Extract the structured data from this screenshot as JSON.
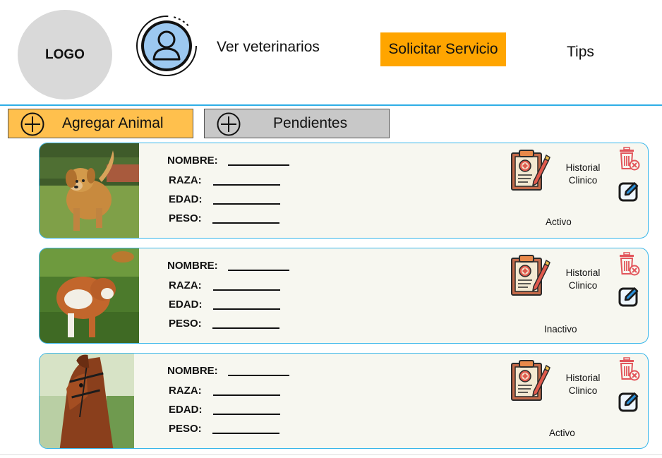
{
  "header": {
    "logo_text": "LOGO",
    "nav": {
      "ver_veterinarios": "Ver veterinarios",
      "solicitar_servicio": "Solicitar Servicio",
      "tips": "Tips"
    }
  },
  "actions": {
    "agregar_label": "Agregar Animal",
    "pendientes_label": "Pendientes"
  },
  "field_labels": {
    "nombre": "NOMBRE:",
    "raza": "RAZA:",
    "edad": "EDAD:",
    "peso": "PESO:"
  },
  "animals": [
    {
      "photo": "dog-photo",
      "historial": "Historial Clinico",
      "status": "Activo"
    },
    {
      "photo": "cow-photo",
      "historial": "Historial Clinico",
      "status": "Inactivo"
    },
    {
      "photo": "horse-photo",
      "historial": "Historial Clinico",
      "status": "Activo"
    }
  ],
  "colors": {
    "accent_orange": "#ffa500",
    "agregar_bg": "#ffc04d",
    "pendientes_bg": "#c8c8c8",
    "card_border": "#38b6ea",
    "card_bg": "#f7f7f0",
    "trash_red": "#e2555b",
    "edit_blue": "#2a8fd8"
  }
}
